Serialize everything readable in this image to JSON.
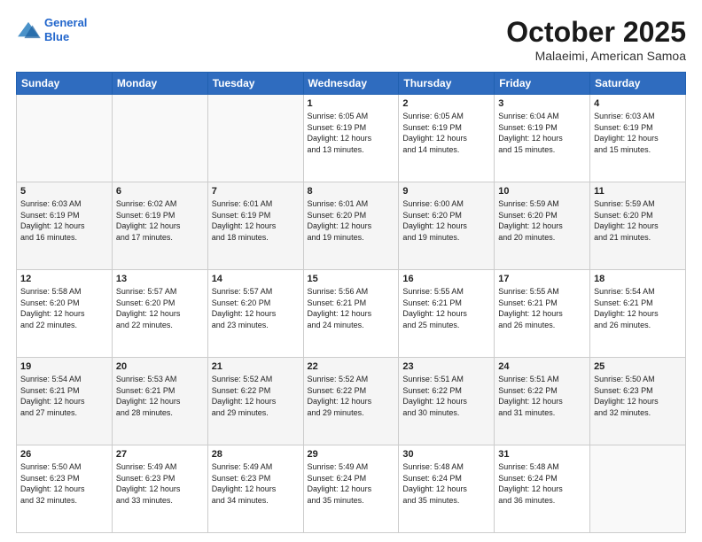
{
  "header": {
    "logo_line1": "General",
    "logo_line2": "Blue",
    "month": "October 2025",
    "location": "Malaeimi, American Samoa"
  },
  "days_of_week": [
    "Sunday",
    "Monday",
    "Tuesday",
    "Wednesday",
    "Thursday",
    "Friday",
    "Saturday"
  ],
  "weeks": [
    [
      {
        "num": "",
        "info": ""
      },
      {
        "num": "",
        "info": ""
      },
      {
        "num": "",
        "info": ""
      },
      {
        "num": "1",
        "info": "Sunrise: 6:05 AM\nSunset: 6:19 PM\nDaylight: 12 hours\nand 13 minutes."
      },
      {
        "num": "2",
        "info": "Sunrise: 6:05 AM\nSunset: 6:19 PM\nDaylight: 12 hours\nand 14 minutes."
      },
      {
        "num": "3",
        "info": "Sunrise: 6:04 AM\nSunset: 6:19 PM\nDaylight: 12 hours\nand 15 minutes."
      },
      {
        "num": "4",
        "info": "Sunrise: 6:03 AM\nSunset: 6:19 PM\nDaylight: 12 hours\nand 15 minutes."
      }
    ],
    [
      {
        "num": "5",
        "info": "Sunrise: 6:03 AM\nSunset: 6:19 PM\nDaylight: 12 hours\nand 16 minutes."
      },
      {
        "num": "6",
        "info": "Sunrise: 6:02 AM\nSunset: 6:19 PM\nDaylight: 12 hours\nand 17 minutes."
      },
      {
        "num": "7",
        "info": "Sunrise: 6:01 AM\nSunset: 6:19 PM\nDaylight: 12 hours\nand 18 minutes."
      },
      {
        "num": "8",
        "info": "Sunrise: 6:01 AM\nSunset: 6:20 PM\nDaylight: 12 hours\nand 19 minutes."
      },
      {
        "num": "9",
        "info": "Sunrise: 6:00 AM\nSunset: 6:20 PM\nDaylight: 12 hours\nand 19 minutes."
      },
      {
        "num": "10",
        "info": "Sunrise: 5:59 AM\nSunset: 6:20 PM\nDaylight: 12 hours\nand 20 minutes."
      },
      {
        "num": "11",
        "info": "Sunrise: 5:59 AM\nSunset: 6:20 PM\nDaylight: 12 hours\nand 21 minutes."
      }
    ],
    [
      {
        "num": "12",
        "info": "Sunrise: 5:58 AM\nSunset: 6:20 PM\nDaylight: 12 hours\nand 22 minutes."
      },
      {
        "num": "13",
        "info": "Sunrise: 5:57 AM\nSunset: 6:20 PM\nDaylight: 12 hours\nand 22 minutes."
      },
      {
        "num": "14",
        "info": "Sunrise: 5:57 AM\nSunset: 6:20 PM\nDaylight: 12 hours\nand 23 minutes."
      },
      {
        "num": "15",
        "info": "Sunrise: 5:56 AM\nSunset: 6:21 PM\nDaylight: 12 hours\nand 24 minutes."
      },
      {
        "num": "16",
        "info": "Sunrise: 5:55 AM\nSunset: 6:21 PM\nDaylight: 12 hours\nand 25 minutes."
      },
      {
        "num": "17",
        "info": "Sunrise: 5:55 AM\nSunset: 6:21 PM\nDaylight: 12 hours\nand 26 minutes."
      },
      {
        "num": "18",
        "info": "Sunrise: 5:54 AM\nSunset: 6:21 PM\nDaylight: 12 hours\nand 26 minutes."
      }
    ],
    [
      {
        "num": "19",
        "info": "Sunrise: 5:54 AM\nSunset: 6:21 PM\nDaylight: 12 hours\nand 27 minutes."
      },
      {
        "num": "20",
        "info": "Sunrise: 5:53 AM\nSunset: 6:21 PM\nDaylight: 12 hours\nand 28 minutes."
      },
      {
        "num": "21",
        "info": "Sunrise: 5:52 AM\nSunset: 6:22 PM\nDaylight: 12 hours\nand 29 minutes."
      },
      {
        "num": "22",
        "info": "Sunrise: 5:52 AM\nSunset: 6:22 PM\nDaylight: 12 hours\nand 29 minutes."
      },
      {
        "num": "23",
        "info": "Sunrise: 5:51 AM\nSunset: 6:22 PM\nDaylight: 12 hours\nand 30 minutes."
      },
      {
        "num": "24",
        "info": "Sunrise: 5:51 AM\nSunset: 6:22 PM\nDaylight: 12 hours\nand 31 minutes."
      },
      {
        "num": "25",
        "info": "Sunrise: 5:50 AM\nSunset: 6:23 PM\nDaylight: 12 hours\nand 32 minutes."
      }
    ],
    [
      {
        "num": "26",
        "info": "Sunrise: 5:50 AM\nSunset: 6:23 PM\nDaylight: 12 hours\nand 32 minutes."
      },
      {
        "num": "27",
        "info": "Sunrise: 5:49 AM\nSunset: 6:23 PM\nDaylight: 12 hours\nand 33 minutes."
      },
      {
        "num": "28",
        "info": "Sunrise: 5:49 AM\nSunset: 6:23 PM\nDaylight: 12 hours\nand 34 minutes."
      },
      {
        "num": "29",
        "info": "Sunrise: 5:49 AM\nSunset: 6:24 PM\nDaylight: 12 hours\nand 35 minutes."
      },
      {
        "num": "30",
        "info": "Sunrise: 5:48 AM\nSunset: 6:24 PM\nDaylight: 12 hours\nand 35 minutes."
      },
      {
        "num": "31",
        "info": "Sunrise: 5:48 AM\nSunset: 6:24 PM\nDaylight: 12 hours\nand 36 minutes."
      },
      {
        "num": "",
        "info": ""
      }
    ]
  ]
}
